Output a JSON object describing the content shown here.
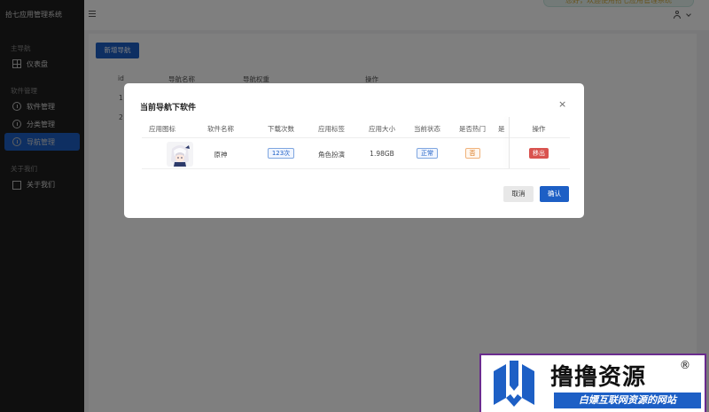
{
  "sidebar": {
    "title": "拾七应用管理系统",
    "groups": [
      {
        "label": "主导航",
        "items": [
          {
            "label": "仪表盘",
            "icon": "dashboard-icon"
          }
        ]
      },
      {
        "label": "软件管理",
        "items": [
          {
            "label": "软件管理",
            "icon": "shield-icon"
          },
          {
            "label": "分类管理",
            "icon": "info-icon"
          },
          {
            "label": "导航管理",
            "icon": "info-icon",
            "active": true
          }
        ]
      },
      {
        "label": "关于我们",
        "items": [
          {
            "label": "关于我们",
            "icon": "monitor-icon"
          }
        ]
      }
    ]
  },
  "header": {
    "toast": "您好，欢迎使用拾七应用管理系统"
  },
  "main": {
    "add_button": "新增导航",
    "columns": [
      "id",
      "导航名称",
      "导航权重",
      "操作"
    ],
    "row_ids": [
      "1",
      "2"
    ]
  },
  "modal": {
    "title": "当前导航下软件",
    "close": "×",
    "columns": [
      "应用图标",
      "软件名称",
      "下载次数",
      "应用标签",
      "应用大小",
      "当前状态",
      "是否热门",
      "是",
      "操作"
    ],
    "row": {
      "name": "原神",
      "downloads": "123次",
      "tag": "角色扮演",
      "size": "1.98GB",
      "status": "正常",
      "hot": "否",
      "delete": "移出"
    },
    "cancel": "取消",
    "confirm": "确认"
  },
  "watermark": {
    "title": "撸撸资源",
    "reg": "®",
    "subtitle": "白嫖互联网资源的网站"
  },
  "colors": {
    "primary": "#1d5fc5",
    "sidebar_bg": "#1f1f1f",
    "danger": "#d9534f",
    "warning": "#d46b08"
  }
}
